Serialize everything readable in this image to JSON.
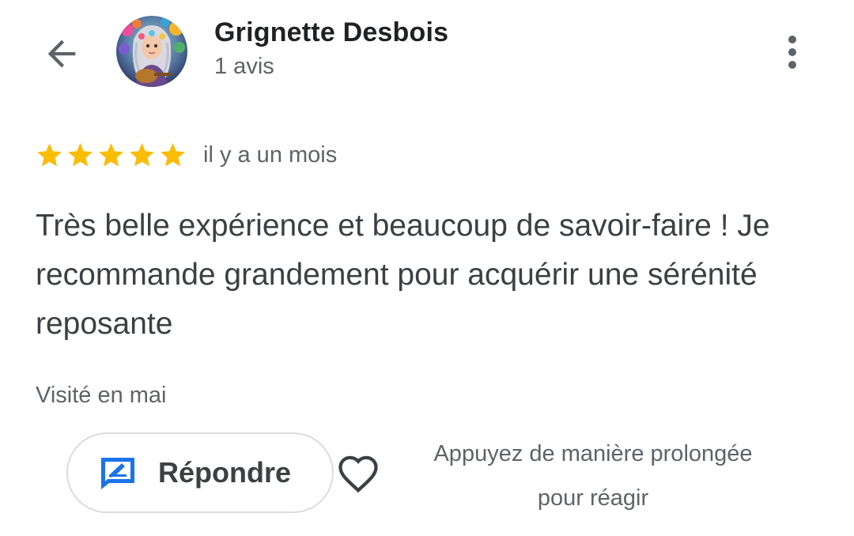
{
  "header": {
    "author_name": "Grignette Desbois",
    "review_count": "1 avis",
    "back_icon": "arrow-left-icon",
    "more_icon": "more-vertical-icon"
  },
  "review": {
    "rating": 5,
    "max_rating": 5,
    "star_color": "#fbbc04",
    "date": "il y a un mois",
    "text": "Très belle expérience et beaucoup de savoir-faire ! Je recommande grandement pour acquérir une sérénité reposante",
    "visit": "Visité en mai"
  },
  "actions": {
    "reply_label": "Répondre",
    "reply_icon": "reply-icon",
    "reply_icon_color": "#1a73e8",
    "heart_icon": "heart-outline-icon",
    "reaction_hint_line1": "Appuyez de manière prolongée",
    "reaction_hint_line2": "pour réagir"
  }
}
